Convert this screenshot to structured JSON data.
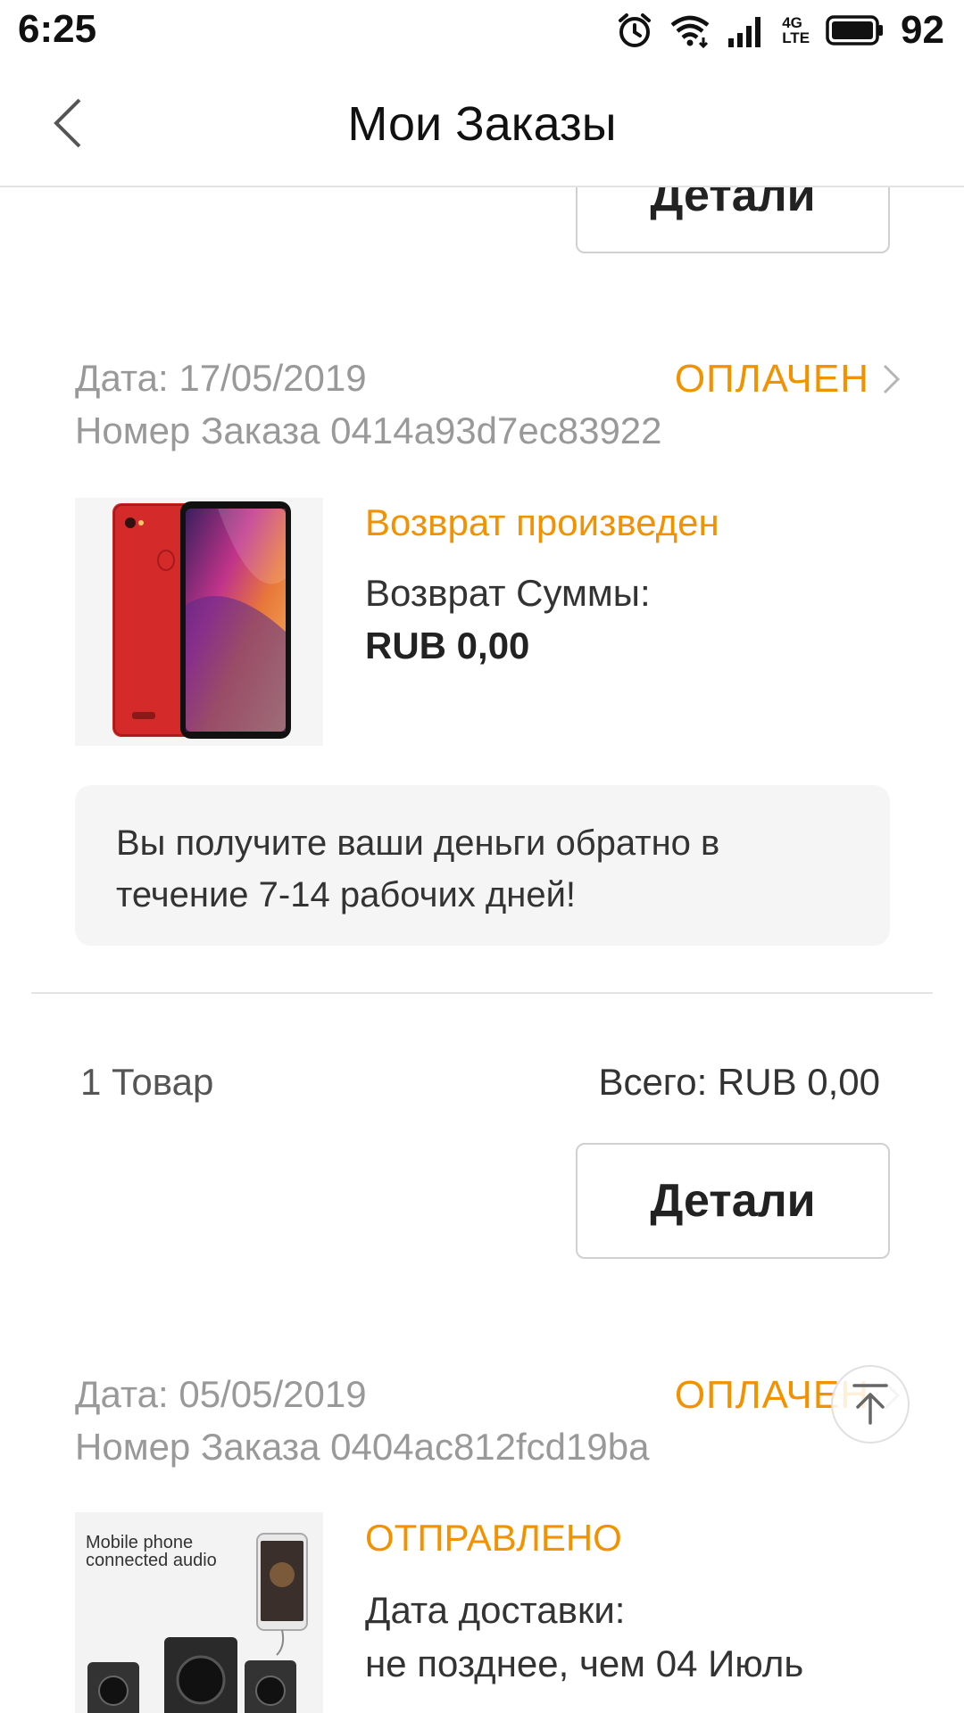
{
  "status_bar": {
    "time": "6:25",
    "network_top": "4G",
    "network_bottom": "LTE",
    "battery_pct": "92"
  },
  "header": {
    "title": "Мои Заказы"
  },
  "orders": [
    {
      "details_label": "Детали"
    },
    {
      "date": "Дата: 17/05/2019",
      "number": "Номер Заказа 0414a93d7ec83922",
      "status": "ОПЛАЧЕН",
      "item_status": "Возврат произведен",
      "refund_label": "Возврат Суммы:",
      "refund_amount": "RUB 0,00",
      "notice": "Вы получите ваши деньги обратно в течение 7-14 рабочих дней!",
      "count": "1 Товар",
      "total": "Всего: RUB 0,00",
      "details_label": "Детали"
    },
    {
      "date": "Дата: 05/05/2019",
      "number": "Номер Заказа 0404ac812fcd19ba",
      "status": "ОПЛАЧЕН",
      "item_status": "ОТПРАВЛЕНО",
      "delivery_label": "Дата доставки:",
      "delivery_value": "не позднее, чем 04 Июль",
      "image_caption_1": "Mobile phone",
      "image_caption_2": "connected audio"
    }
  ],
  "colors": {
    "accent": "#f39200",
    "muted_text": "#999999",
    "notice_bg": "#f5f5f5",
    "divider": "#e3e3e3"
  },
  "icons": {
    "back": "chevron-left-icon",
    "status_chevron": "chevron-right-icon",
    "scroll_top": "arrow-up-to-line-icon",
    "alarm": "alarm-clock-icon",
    "wifi": "wifi-icon",
    "signal": "signal-icon",
    "battery": "battery-icon"
  }
}
